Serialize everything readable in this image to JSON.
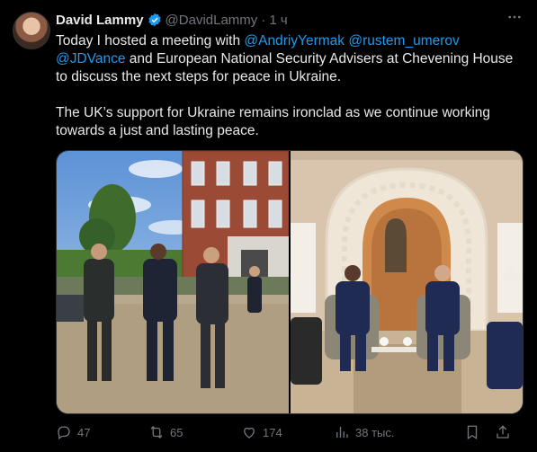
{
  "author": {
    "name": "David Lammy",
    "handle": "@DavidLammy",
    "separator": "·",
    "time": "1 ч"
  },
  "tweet": {
    "p1_a": "Today I hosted a meeting with ",
    "mention1": "@AndriyYermak",
    "mention2": "@rustem_umerov",
    "mention3": "@JDVance",
    "p1_b": " and European National Security Advisers at Chevening House to discuss the next steps for peace in Ukraine.",
    "p2": "The UK’s support for Ukraine remains ironclad as we continue working towards a just and lasting peace."
  },
  "actions": {
    "replies": "47",
    "reposts": "65",
    "likes": "174",
    "views": "38 тыс."
  },
  "icons": [
    "verified-badge-icon",
    "more-icon",
    "reply-icon",
    "repost-icon",
    "like-icon",
    "views-icon",
    "bookmark-icon",
    "share-icon"
  ],
  "colors": {
    "accent": "#1d9bf0",
    "muted": "#71767b",
    "text": "#e7e9ea",
    "background": "#000000"
  }
}
